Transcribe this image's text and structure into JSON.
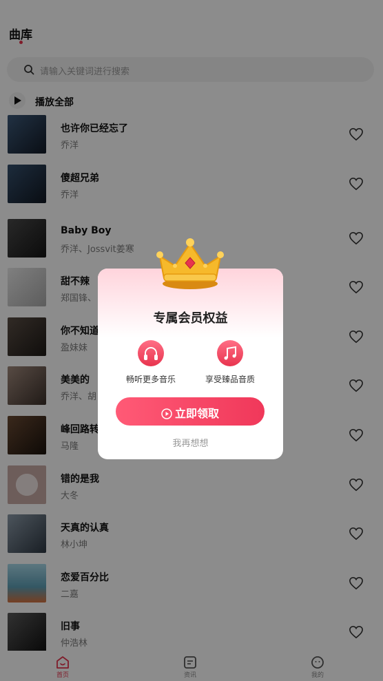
{
  "header": {
    "title": "曲库"
  },
  "search": {
    "placeholder": "请输入关键词进行搜索"
  },
  "play_all": {
    "label": "播放全部"
  },
  "songs": [
    {
      "title": "也许你已经忘了",
      "artist": "乔洋",
      "cover_color": "#1e2a3a"
    },
    {
      "title": "傻超兄弟",
      "artist": "乔洋",
      "cover_color": "#1b2433"
    },
    {
      "title": "Baby Boy",
      "artist": "乔洋、Jossvit姜寒",
      "cover_color": "#2b2b2b"
    },
    {
      "title": "甜不辣",
      "artist": "郑国锋、",
      "cover_color": "#cfcfcf"
    },
    {
      "title": "你不知道",
      "artist": "盈妹妹",
      "cover_color": "#3a3430"
    },
    {
      "title": "美美的",
      "artist": "乔洋、胡",
      "cover_color": "#6c5a52"
    },
    {
      "title": "峰回路转",
      "artist": "马隆",
      "cover_color": "#3a2a20"
    },
    {
      "title": "错的是我",
      "artist": "大冬",
      "cover_color": "#d9c7c3"
    },
    {
      "title": "天真的认真",
      "artist": "林小坤",
      "cover_color": "#5b6a7a"
    },
    {
      "title": "恋爱百分比",
      "artist": "二嘉",
      "cover_color": "#7fb6c9"
    },
    {
      "title": "旧事",
      "artist": "仲浩林",
      "cover_color": "#2e2e2e"
    }
  ],
  "tabbar": {
    "items": [
      {
        "label": "首页",
        "icon": "home-icon",
        "active": true
      },
      {
        "label": "资讯",
        "icon": "news-icon",
        "active": false
      },
      {
        "label": "我的",
        "icon": "profile-icon",
        "active": false
      }
    ]
  },
  "modal": {
    "title": "专属会员权益",
    "benefits": [
      {
        "label": "畅听更多音乐",
        "icon": "headphones-icon"
      },
      {
        "label": "享受臻品音质",
        "icon": "music-note-icon"
      }
    ],
    "claim_label": "立即领取",
    "dismiss_label": "我再想想"
  },
  "colors": {
    "accent": "#e8344e",
    "crown": "#f6b92b"
  }
}
